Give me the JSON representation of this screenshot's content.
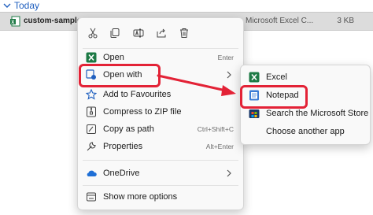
{
  "explorer": {
    "group_title": "Today",
    "file": {
      "name": "custom-sample-a",
      "type": "Microsoft Excel C...",
      "size": "3 KB"
    }
  },
  "context_menu": {
    "toolbar": [
      "cut-icon",
      "copy-icon",
      "rename-icon",
      "share-icon",
      "delete-icon"
    ],
    "items": [
      {
        "label": "Open",
        "shortcut": "Enter",
        "icon": "excel-icon"
      },
      {
        "label": "Open with",
        "icon": "open-with-icon",
        "has_submenu": true
      },
      {
        "label": "Add to Favourites",
        "icon": "star-icon"
      },
      {
        "label": "Compress to ZIP file",
        "icon": "zip-icon"
      },
      {
        "label": "Copy as path",
        "shortcut": "Ctrl+Shift+C",
        "icon": "path-icon"
      },
      {
        "label": "Properties",
        "shortcut": "Alt+Enter",
        "icon": "wrench-icon"
      },
      {
        "label": "OneDrive",
        "icon": "cloud-icon",
        "has_submenu": true
      },
      {
        "label": "Show more options",
        "icon": "more-options-icon"
      }
    ]
  },
  "open_with_submenu": {
    "items": [
      {
        "label": "Excel",
        "icon": "excel-icon"
      },
      {
        "label": "Notepad",
        "icon": "notepad-icon"
      },
      {
        "label": "Search the Microsoft Store",
        "icon": "store-icon"
      },
      {
        "label": "Choose another app",
        "icon": "none"
      }
    ]
  },
  "colors": {
    "highlight": "#e32236",
    "accent": "#1f5fbf",
    "excel_green": "#1d7a45"
  }
}
